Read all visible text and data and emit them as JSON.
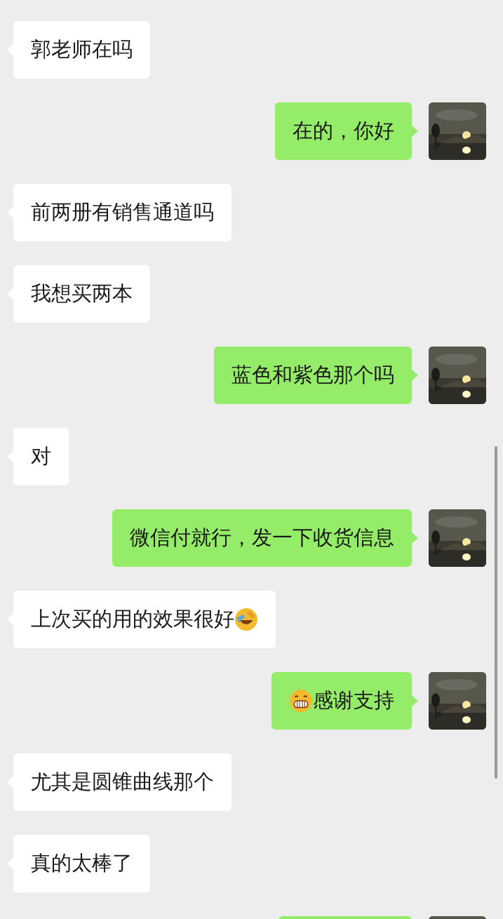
{
  "messages": [
    {
      "kind": "incoming",
      "text": "郭老师在吗"
    },
    {
      "kind": "outgoing",
      "text": "在的，你好"
    },
    {
      "kind": "incoming",
      "text": "前两册有销售通道吗"
    },
    {
      "kind": "incoming",
      "text": "我想买两本"
    },
    {
      "kind": "outgoing",
      "text": "蓝色和紫色那个吗"
    },
    {
      "kind": "incoming",
      "text": "对"
    },
    {
      "kind": "outgoing",
      "text": "微信付就行，发一下收货信息"
    },
    {
      "kind": "incoming",
      "text": "上次买的用的效果很好",
      "emoji_after": true
    },
    {
      "kind": "outgoing",
      "text": "感谢支持",
      "emoji_before": true
    },
    {
      "kind": "incoming",
      "text": "尤其是圆锥曲线那个"
    },
    {
      "kind": "incoming",
      "text": "真的太棒了"
    },
    {
      "kind": "outgoing",
      "cut": true
    }
  ]
}
